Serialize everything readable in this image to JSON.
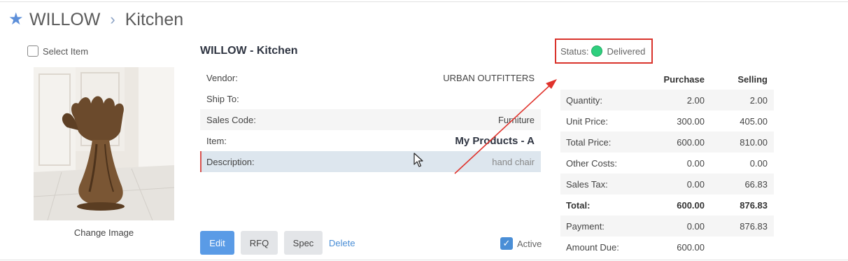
{
  "breadcrumb": {
    "root": "WILLOW",
    "separator": "›",
    "current": "Kitchen"
  },
  "left": {
    "select_label": "Select Item",
    "change_image_label": "Change Image"
  },
  "detail": {
    "title": "WILLOW - Kitchen",
    "rows": [
      {
        "label": "Vendor:",
        "value": "URBAN OUTFITTERS"
      },
      {
        "label": "Ship To:",
        "value": ""
      },
      {
        "label": "Sales Code:",
        "value": "Furniture"
      },
      {
        "label": "Item:",
        "value": "My Products - A"
      },
      {
        "label": "Description:",
        "value": "hand chair"
      }
    ]
  },
  "actions": {
    "edit": "Edit",
    "rfq": "RFQ",
    "spec": "Spec",
    "delete": "Delete",
    "active": "Active",
    "active_checked": true
  },
  "status": {
    "label": "Status:",
    "value": "Delivered",
    "color": "#2fcf7e"
  },
  "pricing": {
    "headers": {
      "label": "",
      "purchase": "Purchase",
      "selling": "Selling"
    },
    "rows": [
      {
        "label": "Quantity:",
        "purchase": "2.00",
        "selling": "2.00"
      },
      {
        "label": "Unit Price:",
        "purchase": "300.00",
        "selling": "405.00"
      },
      {
        "label": "Total Price:",
        "purchase": "600.00",
        "selling": "810.00"
      },
      {
        "label": "Other Costs:",
        "purchase": "0.00",
        "selling": "0.00"
      },
      {
        "label": "Sales Tax:",
        "purchase": "0.00",
        "selling": "66.83"
      },
      {
        "label": "Total:",
        "purchase": "600.00",
        "selling": "876.83"
      },
      {
        "label": "Payment:",
        "purchase": "0.00",
        "selling": "876.83"
      },
      {
        "label": "Amount Due:",
        "purchase": "600.00",
        "selling": ""
      }
    ]
  },
  "icons": {
    "favorite": "star-icon",
    "cursor": "mouse-pointer-icon",
    "annotation": "red-arrow-icon"
  },
  "colors": {
    "accent": "#5a9be6",
    "link": "#4a8ed6",
    "highlight_box": "#d9332c"
  }
}
